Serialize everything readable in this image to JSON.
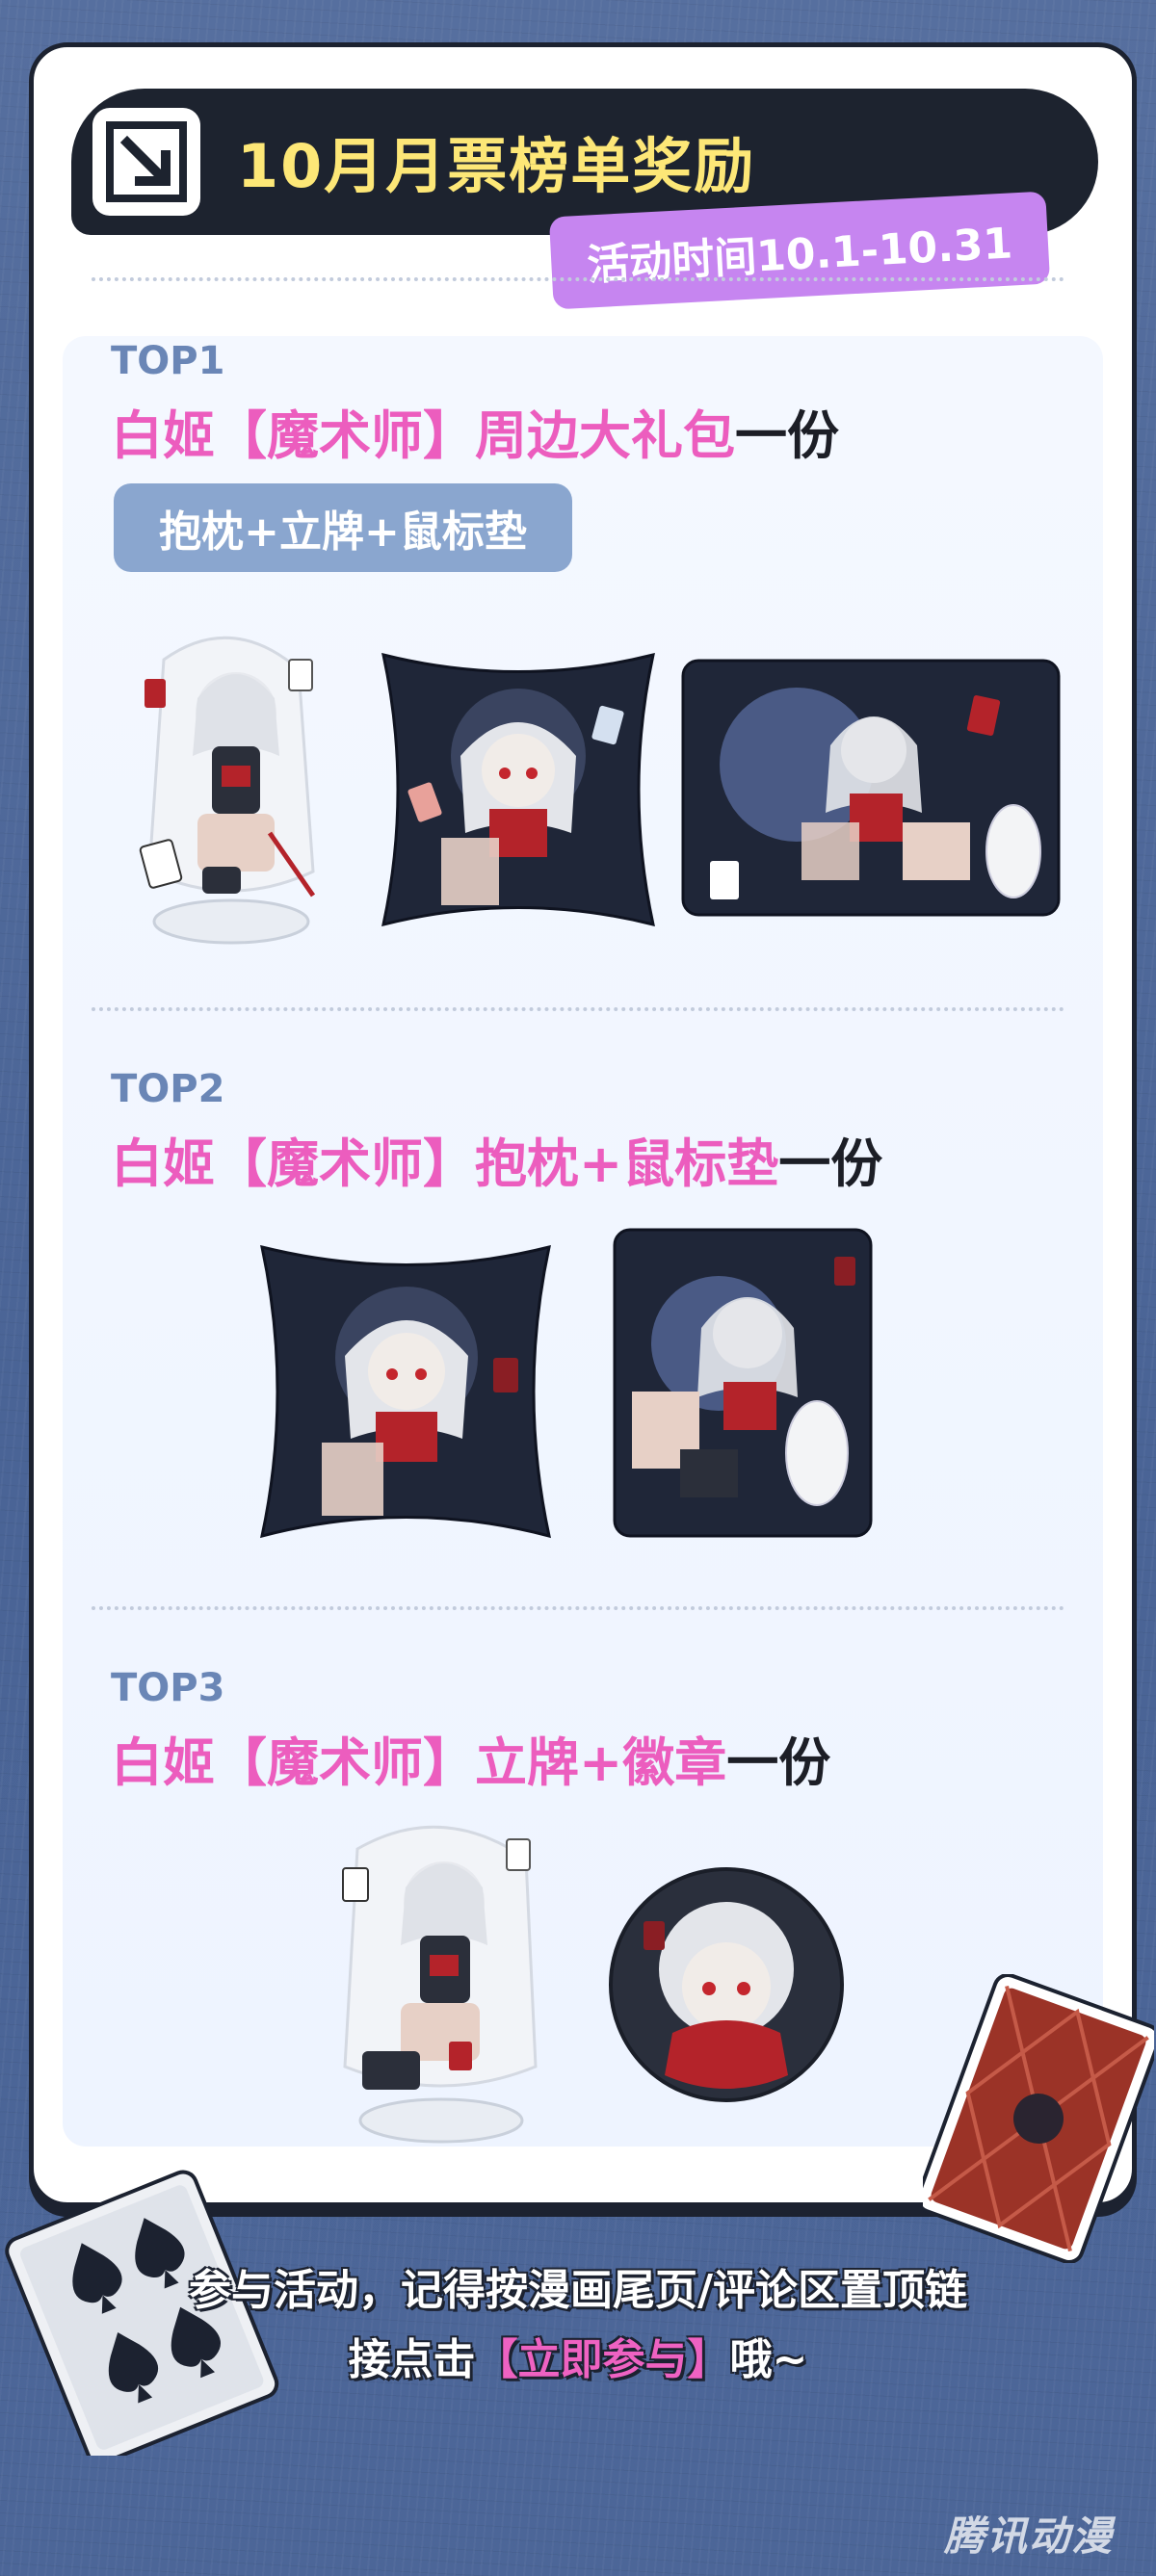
{
  "header": {
    "title": "10月月票榜单奖励",
    "date_range": "活动时间10.1-10.31",
    "icon": "arrow-down-right-icon"
  },
  "tiers": [
    {
      "rank": "TOP1",
      "reward_highlight": "白姬【魔术师】周边大礼包",
      "reward_suffix": "一份",
      "items_label": "抱枕+立牌+鼠标垫",
      "products": [
        "acrylic-stand",
        "pillow",
        "mouse-pad"
      ]
    },
    {
      "rank": "TOP2",
      "reward_highlight": "白姬【魔术师】抱枕+鼠标垫",
      "reward_suffix": "一份",
      "products": [
        "pillow",
        "mouse-pad"
      ]
    },
    {
      "rank": "TOP3",
      "reward_highlight": "白姬【魔术师】立牌+徽章",
      "reward_suffix": "一份",
      "products": [
        "acrylic-stand",
        "badge"
      ]
    }
  ],
  "footer": {
    "line1": "参与活动，记得按漫画尾页/评论区置顶链",
    "line2_prefix": "接点击",
    "line2_highlight": "【立即参与】",
    "line2_suffix": "哦~"
  },
  "watermark": "腾讯动漫",
  "colors": {
    "background": "#4f6a9f",
    "title": "#fde777",
    "highlight_pink": "#ec5dbe",
    "badge_purple": "#c685f0",
    "pill_blue": "#8aa6cf",
    "rank_blue": "#6a86b6"
  }
}
